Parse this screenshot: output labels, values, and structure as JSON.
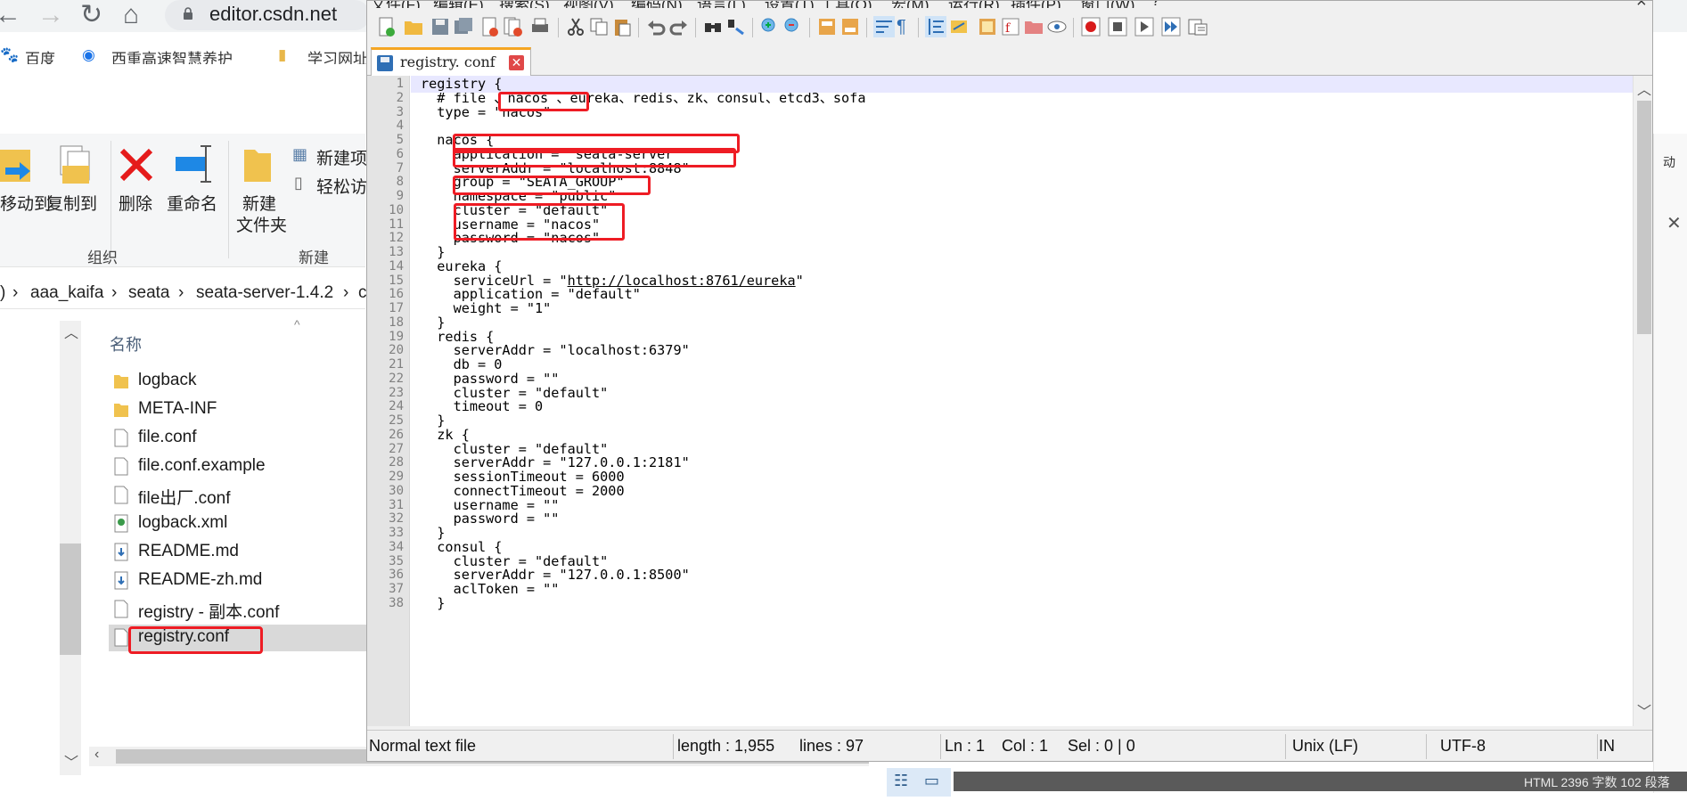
{
  "browser": {
    "back": "←",
    "forward": "→",
    "reload": "↻",
    "home": "⌂",
    "url": "editor.csdn.net",
    "bookmarks": [
      "百度",
      "西重高速智慧养护",
      "学习网址"
    ]
  },
  "explorer": {
    "ribbon": {
      "move_to": "移动到",
      "copy_to": "复制到",
      "delete": "删除",
      "rename": "重命名",
      "new_folder_l1": "新建",
      "new_folder_l2": "文件夹",
      "new_item": "新建项",
      "easy_access": "轻松访",
      "group_organize": "组织",
      "group_new": "新建",
      "right_label": "动"
    },
    "path": [
      ")",
      "aaa_kaifa",
      "seata",
      "seata-server-1.4.2",
      "c"
    ],
    "column_name": "名称",
    "files": [
      {
        "name": "logback",
        "type": "folder"
      },
      {
        "name": "META-INF",
        "type": "folder"
      },
      {
        "name": "file.conf",
        "type": "file"
      },
      {
        "name": "file.conf.example",
        "type": "file"
      },
      {
        "name": "file出厂.conf",
        "type": "file"
      },
      {
        "name": "logback.xml",
        "type": "xml"
      },
      {
        "name": "README.md",
        "type": "md"
      },
      {
        "name": "README-zh.md",
        "type": "md"
      },
      {
        "name": "registry - 副本.conf",
        "type": "file"
      },
      {
        "name": "registry.conf",
        "type": "file",
        "selected": true
      }
    ],
    "watermark": "HTML 2396 字数 102 段落"
  },
  "notepad": {
    "menu": [
      "文件(F)",
      "编辑(E)",
      "搜索(S)",
      "视图(V)",
      "编码(N)",
      "语言(L)",
      "设置(T)",
      "工具(O)",
      "宏(M)",
      "运行(R)",
      "插件(P)",
      "窗口(W)",
      "?"
    ],
    "close": "×",
    "tab": {
      "label": "registry. conf",
      "close": "✕"
    },
    "lines": [
      "registry {",
      "  # file 、nacos 、eureka、redis、zk、consul、etcd3、sofa",
      "  type = \"nacos\"",
      "",
      "  nacos {",
      "    application = \"seata-server\"",
      "    serverAddr = \"localhost:8848\"",
      "    group = \"SEATA_GROUP\"",
      "    namespace = \"public\"",
      "    cluster = \"default\"",
      "    username = \"nacos\"",
      "    password = \"nacos\"",
      "  }",
      "  eureka {",
      "    serviceUrl = \"http://localhost:8761/eureka\"",
      "    application = \"default\"",
      "    weight = \"1\"",
      "  }",
      "  redis {",
      "    serverAddr = \"localhost:6379\"",
      "    db = 0",
      "    password = \"\"",
      "    cluster = \"default\"",
      "    timeout = 0",
      "  }",
      "  zk {",
      "    cluster = \"default\"",
      "    serverAddr = \"127.0.0.1:2181\"",
      "    sessionTimeout = 6000",
      "    connectTimeout = 2000",
      "    username = \"\"",
      "    password = \"\"",
      "  }",
      "  consul {",
      "    cluster = \"default\"",
      "    serverAddr = \"127.0.0.1:8500\"",
      "    aclToken = \"\"",
      "  }"
    ],
    "url_line_prefix": "    serviceUrl = \"",
    "url_text": "http://localhost:8761/eureka",
    "url_line_suffix": "\"",
    "status": {
      "type": "Normal text file",
      "length": "length : 1,955",
      "lines": "lines : 97",
      "ln": "Ln : 1",
      "col": "Col : 1",
      "sel": "Sel : 0 | 0",
      "eol": "Unix (LF)",
      "encoding": "UTF-8",
      "mode": "IN"
    },
    "scroll_up": "︿",
    "scroll_down": "﹀"
  },
  "colors": {
    "highlight_red": "#ee1c24",
    "tab_accent": "#f5a623",
    "current_line": "#e8e8ff"
  }
}
